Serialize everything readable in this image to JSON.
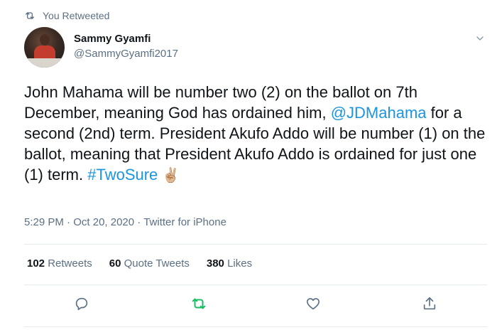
{
  "retweet_context": {
    "label": "You Retweeted",
    "icon": "retweet-icon"
  },
  "user": {
    "name": "Sammy Gyamfi",
    "handle": "@SammyGyamfi2017"
  },
  "tweet": {
    "text_part1": "John Mahama will be number two (2) on the ballot on 7th December, meaning God has ordained him, ",
    "mention": "@JDMahama",
    "text_part2": " for a second (2nd) term. President Akufo Addo will be number (1) on the ballot, meaning that President Akufo Addo is ordained for just one (1) term. ",
    "hashtag": "#TwoSure",
    "emoji": "✌🏼"
  },
  "meta": {
    "time": "5:29 PM",
    "date": "Oct 20, 2020",
    "source": "Twitter for iPhone",
    "separator": "·"
  },
  "stats": {
    "retweets_count": "102",
    "retweets_label": "Retweets",
    "quotes_count": "60",
    "quotes_label": "Quote Tweets",
    "likes_count": "380",
    "likes_label": "Likes"
  },
  "colors": {
    "link": "#1b95e0",
    "secondary_text": "#5b7083",
    "retweet_active": "#17bf63",
    "divider": "#e6ecf0"
  },
  "icons": [
    "retweet-icon",
    "chevron-down-icon",
    "reply-icon",
    "retweet-icon",
    "like-icon",
    "share-icon"
  ]
}
